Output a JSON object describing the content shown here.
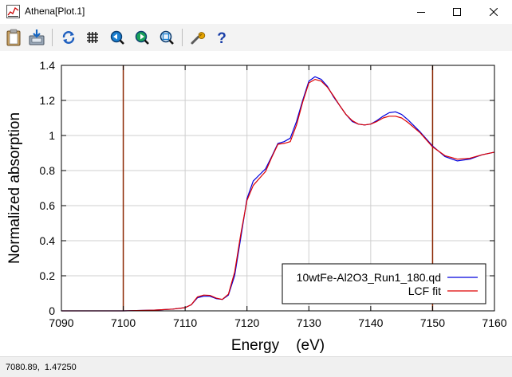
{
  "window": {
    "title": "Athena[Plot.1]",
    "controls": {
      "minimize": "minimize-icon",
      "maximize": "maximize-icon",
      "close": "close-icon"
    }
  },
  "toolbar": {
    "icons": [
      "clipboard-icon",
      "save-icon",
      "refresh-icon",
      "grid-icon",
      "zoom-back-icon",
      "zoom-forward-icon",
      "zoom-icon",
      "wrench-icon",
      "help-icon"
    ]
  },
  "status": {
    "coords": "7080.89,  1.47250"
  },
  "chart_data": {
    "type": "line",
    "xlabel": "Energy    (eV)",
    "ylabel": "Normalized absorption",
    "xlim": [
      7090,
      7160
    ],
    "ylim": [
      0,
      1.4
    ],
    "xticks": [
      "7090",
      "7100",
      "7110",
      "7120",
      "7130",
      "7140",
      "7150",
      "7160"
    ],
    "yticks": [
      "0",
      "0.2",
      "0.4",
      "0.6",
      "0.8",
      "1",
      "1.2",
      "1.4"
    ],
    "grid": true,
    "legend_position": "bottom-right",
    "vlines": [
      {
        "x": 7100,
        "color": "#8b2500"
      },
      {
        "x": 7150,
        "color": "#8b2500"
      }
    ],
    "series": [
      {
        "name": "10wtFe-Al2O3_Run1_180.qd",
        "color": "#0000dd",
        "points": [
          [
            7090,
            0.0
          ],
          [
            7100,
            0.0
          ],
          [
            7105,
            0.004
          ],
          [
            7108,
            0.01
          ],
          [
            7110,
            0.018
          ],
          [
            7111,
            0.035
          ],
          [
            7112,
            0.075
          ],
          [
            7113,
            0.083
          ],
          [
            7114,
            0.083
          ],
          [
            7115,
            0.07
          ],
          [
            7116,
            0.065
          ],
          [
            7117,
            0.09
          ],
          [
            7118,
            0.2
          ],
          [
            7119,
            0.42
          ],
          [
            7120,
            0.64
          ],
          [
            7121,
            0.74
          ],
          [
            7122,
            0.775
          ],
          [
            7123,
            0.81
          ],
          [
            7124,
            0.88
          ],
          [
            7125,
            0.955
          ],
          [
            7126,
            0.965
          ],
          [
            7127,
            0.985
          ],
          [
            7128,
            1.08
          ],
          [
            7129,
            1.2
          ],
          [
            7130,
            1.31
          ],
          [
            7131,
            1.335
          ],
          [
            7132,
            1.32
          ],
          [
            7133,
            1.28
          ],
          [
            7134,
            1.22
          ],
          [
            7135,
            1.17
          ],
          [
            7136,
            1.12
          ],
          [
            7137,
            1.08
          ],
          [
            7138,
            1.065
          ],
          [
            7139,
            1.06
          ],
          [
            7140,
            1.065
          ],
          [
            7141,
            1.085
          ],
          [
            7142,
            1.11
          ],
          [
            7143,
            1.13
          ],
          [
            7144,
            1.135
          ],
          [
            7145,
            1.12
          ],
          [
            7146,
            1.09
          ],
          [
            7148,
            1.02
          ],
          [
            7150,
            0.94
          ],
          [
            7152,
            0.88
          ],
          [
            7154,
            0.855
          ],
          [
            7156,
            0.865
          ],
          [
            7158,
            0.89
          ],
          [
            7160,
            0.905
          ]
        ]
      },
      {
        "name": "LCF fit",
        "color": "#dd0000",
        "points": [
          [
            7090,
            0.0
          ],
          [
            7100,
            0.0
          ],
          [
            7105,
            0.004
          ],
          [
            7108,
            0.01
          ],
          [
            7110,
            0.018
          ],
          [
            7111,
            0.035
          ],
          [
            7112,
            0.08
          ],
          [
            7113,
            0.09
          ],
          [
            7114,
            0.088
          ],
          [
            7115,
            0.073
          ],
          [
            7116,
            0.065
          ],
          [
            7117,
            0.095
          ],
          [
            7118,
            0.22
          ],
          [
            7119,
            0.44
          ],
          [
            7120,
            0.63
          ],
          [
            7121,
            0.715
          ],
          [
            7122,
            0.755
          ],
          [
            7123,
            0.795
          ],
          [
            7124,
            0.875
          ],
          [
            7125,
            0.95
          ],
          [
            7126,
            0.955
          ],
          [
            7127,
            0.965
          ],
          [
            7128,
            1.06
          ],
          [
            7129,
            1.19
          ],
          [
            7130,
            1.3
          ],
          [
            7131,
            1.32
          ],
          [
            7132,
            1.31
          ],
          [
            7133,
            1.275
          ],
          [
            7134,
            1.225
          ],
          [
            7135,
            1.17
          ],
          [
            7136,
            1.12
          ],
          [
            7137,
            1.085
          ],
          [
            7138,
            1.065
          ],
          [
            7139,
            1.06
          ],
          [
            7140,
            1.065
          ],
          [
            7141,
            1.08
          ],
          [
            7142,
            1.1
          ],
          [
            7143,
            1.11
          ],
          [
            7144,
            1.11
          ],
          [
            7145,
            1.1
          ],
          [
            7146,
            1.075
          ],
          [
            7148,
            1.015
          ],
          [
            7150,
            0.935
          ],
          [
            7152,
            0.885
          ],
          [
            7154,
            0.865
          ],
          [
            7156,
            0.87
          ],
          [
            7158,
            0.89
          ],
          [
            7160,
            0.905
          ]
        ]
      }
    ]
  }
}
